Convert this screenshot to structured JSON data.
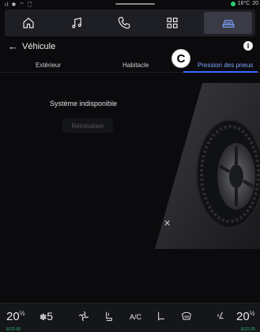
{
  "status_bar": {
    "left_icons": "ıl ✱ ⌔ 🗋",
    "temperature": "16°C",
    "time": "20"
  },
  "top_nav": {
    "items": [
      {
        "name": "home",
        "icon": "home-icon"
      },
      {
        "name": "music",
        "icon": "music-note-icon"
      },
      {
        "name": "phone",
        "icon": "phone-icon"
      },
      {
        "name": "apps",
        "icon": "grid-icon"
      },
      {
        "name": "vehicle",
        "icon": "car-icon",
        "active": true
      }
    ],
    "accent_color": "#7da2ff"
  },
  "header": {
    "back_symbol": "←",
    "title": "Véhicule",
    "info_symbol": "i"
  },
  "tabs": [
    {
      "label": "Extérieur"
    },
    {
      "label": "Habitacle"
    },
    {
      "label": "Pression des pneus",
      "active": true
    }
  ],
  "callout": {
    "label": "C"
  },
  "main": {
    "status_text": "Système indisponible",
    "reset_label": "Réinitialiser",
    "close_symbol": "✕"
  },
  "bottom_bar": {
    "left_temp": "20",
    "left_temp_unit": "½",
    "left_eco": "ECO 00",
    "fan_speed": "5",
    "ac_label": "A/C",
    "right_temp": "20",
    "right_temp_unit": "½",
    "right_eco": "ECO 20"
  }
}
